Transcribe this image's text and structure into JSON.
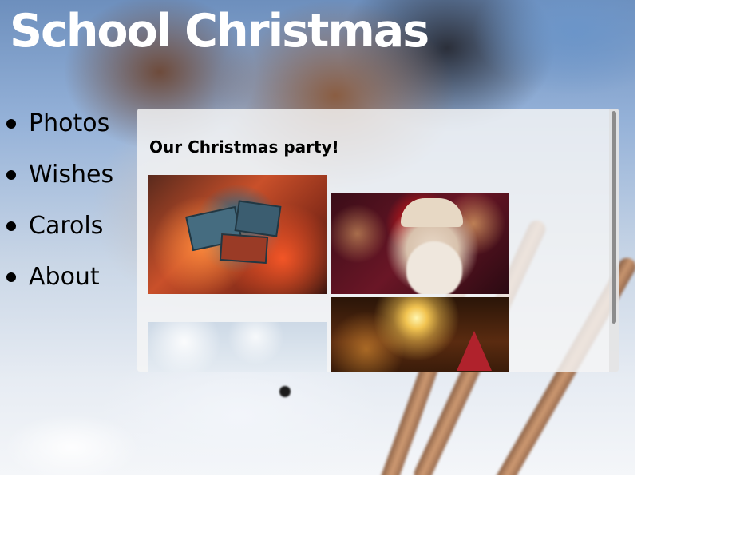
{
  "page": {
    "title": "School Christmas"
  },
  "nav": {
    "items": [
      {
        "label": "Photos"
      },
      {
        "label": "Wishes"
      },
      {
        "label": "Carols"
      },
      {
        "label": "About"
      }
    ]
  },
  "panel": {
    "heading": "Our Christmas party!",
    "photos": [
      {
        "subject": "presents-photo"
      },
      {
        "subject": "santa-photo"
      },
      {
        "subject": "snow-bokeh-photo"
      },
      {
        "subject": "star-gnome-photo"
      }
    ]
  }
}
